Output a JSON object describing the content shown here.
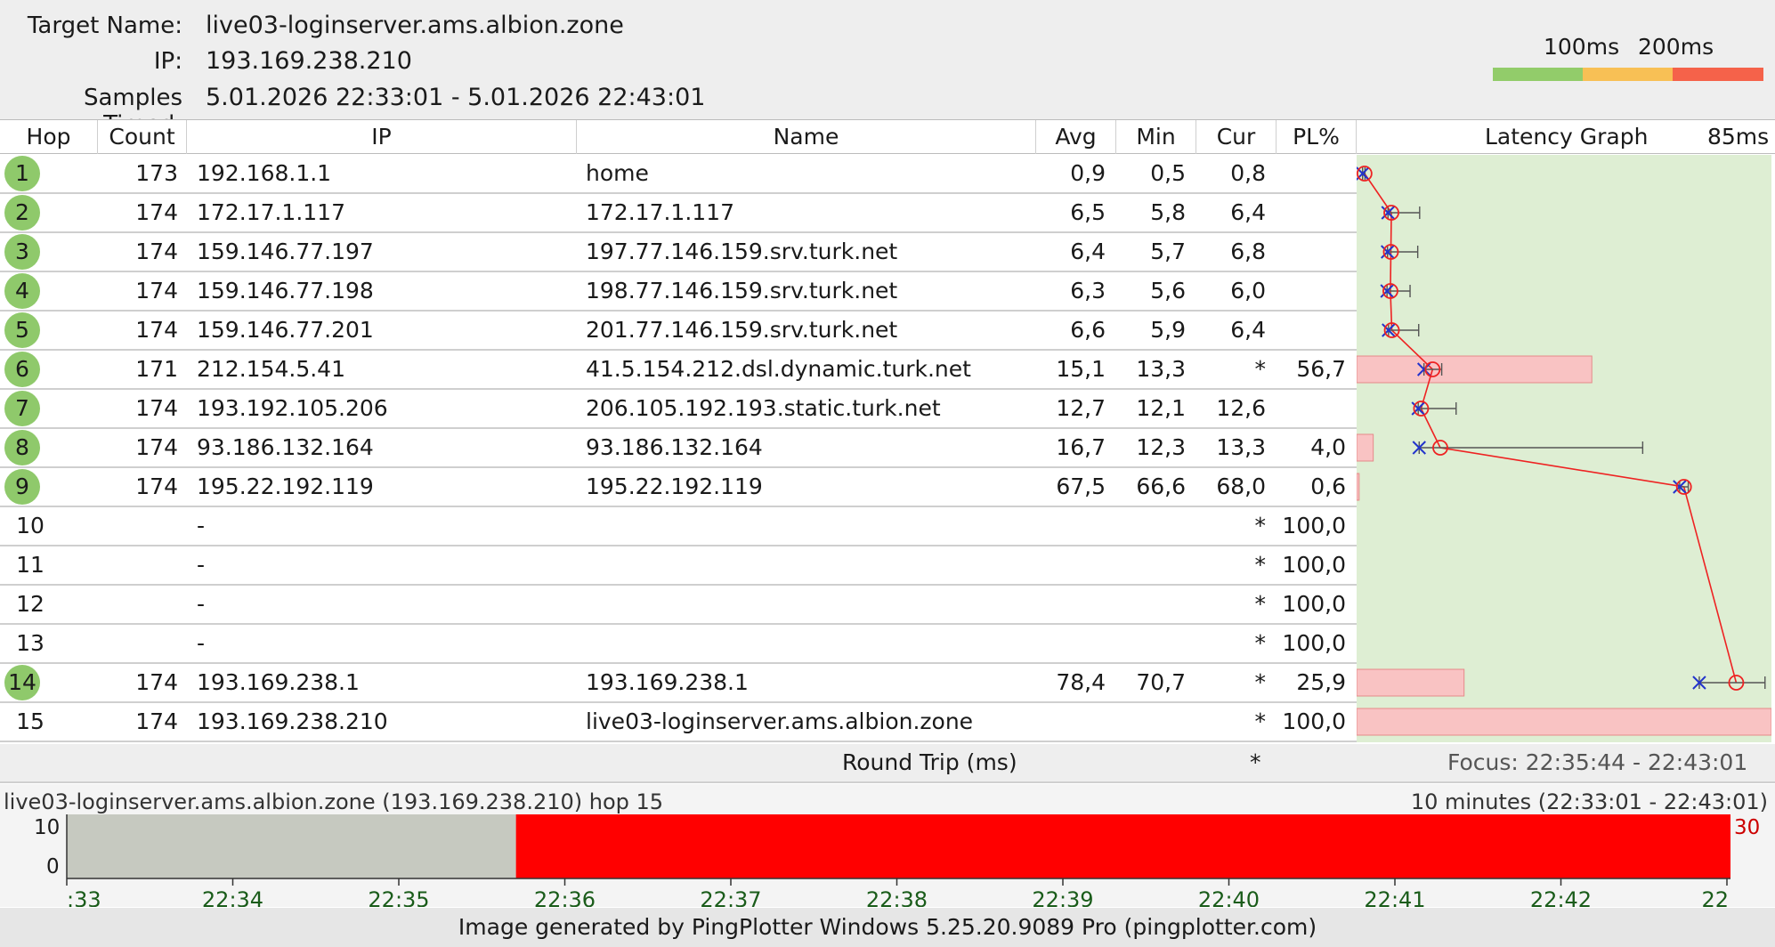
{
  "header": {
    "target_label": "Target Name:",
    "target_value": "live03-loginserver.ams.albion.zone",
    "ip_label": "IP:",
    "ip_value": "193.169.238.210",
    "samples_label": "Samples Timed:",
    "samples_value": "5.01.2026 22:33:01 - 5.01.2026 22:43:01",
    "legend_100": "100ms",
    "legend_200": "200ms",
    "legend_colors": [
      "#92cc6a",
      "#f8c055",
      "#f5624a"
    ]
  },
  "columns": {
    "hop": "Hop",
    "count": "Count",
    "ip": "IP",
    "name": "Name",
    "avg": "Avg",
    "min": "Min",
    "cur": "Cur",
    "pl": "PL%",
    "graph": "Latency Graph",
    "graph_scale": "85ms"
  },
  "hops": [
    {
      "hop": "1",
      "count": "173",
      "ip": "192.168.1.1",
      "name": "home",
      "avg": "0,9",
      "min": "0,5",
      "cur": "0,8",
      "pl": "",
      "responding": true
    },
    {
      "hop": "2",
      "count": "174",
      "ip": "172.17.1.117",
      "name": "172.17.1.117",
      "avg": "6,5",
      "min": "5,8",
      "cur": "6,4",
      "pl": "",
      "responding": true
    },
    {
      "hop": "3",
      "count": "174",
      "ip": "159.146.77.197",
      "name": "197.77.146.159.srv.turk.net",
      "avg": "6,4",
      "min": "5,7",
      "cur": "6,8",
      "pl": "",
      "responding": true
    },
    {
      "hop": "4",
      "count": "174",
      "ip": "159.146.77.198",
      "name": "198.77.146.159.srv.turk.net",
      "avg": "6,3",
      "min": "5,6",
      "cur": "6,0",
      "pl": "",
      "responding": true
    },
    {
      "hop": "5",
      "count": "174",
      "ip": "159.146.77.201",
      "name": "201.77.146.159.srv.turk.net",
      "avg": "6,6",
      "min": "5,9",
      "cur": "6,4",
      "pl": "",
      "responding": true
    },
    {
      "hop": "6",
      "count": "171",
      "ip": "212.154.5.41",
      "name": "41.5.154.212.dsl.dynamic.turk.net",
      "avg": "15,1",
      "min": "13,3",
      "cur": "*",
      "pl": "56,7",
      "responding": true
    },
    {
      "hop": "7",
      "count": "174",
      "ip": "193.192.105.206",
      "name": "206.105.192.193.static.turk.net",
      "avg": "12,7",
      "min": "12,1",
      "cur": "12,6",
      "pl": "",
      "responding": true
    },
    {
      "hop": "8",
      "count": "174",
      "ip": "93.186.132.164",
      "name": "93.186.132.164",
      "avg": "16,7",
      "min": "12,3",
      "cur": "13,3",
      "pl": "4,0",
      "responding": true
    },
    {
      "hop": "9",
      "count": "174",
      "ip": "195.22.192.119",
      "name": "195.22.192.119",
      "avg": "67,5",
      "min": "66,6",
      "cur": "68,0",
      "pl": "0,6",
      "responding": true
    },
    {
      "hop": "10",
      "count": "",
      "ip": "-",
      "name": "",
      "avg": "",
      "min": "",
      "cur": "*",
      "pl": "100,0",
      "responding": false
    },
    {
      "hop": "11",
      "count": "",
      "ip": "-",
      "name": "",
      "avg": "",
      "min": "",
      "cur": "*",
      "pl": "100,0",
      "responding": false
    },
    {
      "hop": "12",
      "count": "",
      "ip": "-",
      "name": "",
      "avg": "",
      "min": "",
      "cur": "*",
      "pl": "100,0",
      "responding": false
    },
    {
      "hop": "13",
      "count": "",
      "ip": "-",
      "name": "",
      "avg": "",
      "min": "",
      "cur": "*",
      "pl": "100,0",
      "responding": false
    },
    {
      "hop": "14",
      "count": "174",
      "ip": "193.169.238.1",
      "name": "193.169.238.1",
      "avg": "78,4",
      "min": "70,7",
      "cur": "*",
      "pl": "25,9",
      "responding": true
    },
    {
      "hop": "15",
      "count": "174",
      "ip": "193.169.238.210",
      "name": "live03-loginserver.ams.albion.zone",
      "avg": "",
      "min": "",
      "cur": "*",
      "pl": "100,0",
      "responding": false
    }
  ],
  "graph": {
    "scale_max_ms": 85,
    "colors": {
      "bg": "#deeed3",
      "loss": "#f9c3c3",
      "line": "#ee2222",
      "min_marker": "#2233cc"
    },
    "points": [
      {
        "avg": 0.9,
        "min": 0.5,
        "max": 1.0,
        "loss": 0
      },
      {
        "avg": 6.5,
        "min": 5.8,
        "max": 12.4,
        "loss": 0
      },
      {
        "avg": 6.4,
        "min": 5.7,
        "max": 12.0,
        "loss": 0
      },
      {
        "avg": 6.3,
        "min": 5.6,
        "max": 10.4,
        "loss": 0
      },
      {
        "avg": 6.6,
        "min": 5.9,
        "max": 12.2,
        "loss": 0
      },
      {
        "avg": 15.1,
        "min": 13.3,
        "max": 17.0,
        "loss": 56.7
      },
      {
        "avg": 12.7,
        "min": 12.1,
        "max": 20.0,
        "loss": 0
      },
      {
        "avg": 16.7,
        "min": 12.3,
        "max": 58.9,
        "loss": 4.0
      },
      {
        "avg": 67.5,
        "min": 66.6,
        "max": 68.4,
        "loss": 0.6
      },
      {
        "avg": null,
        "min": null,
        "max": null,
        "loss": 0
      },
      {
        "avg": null,
        "min": null,
        "max": null,
        "loss": 0
      },
      {
        "avg": null,
        "min": null,
        "max": null,
        "loss": 0
      },
      {
        "avg": null,
        "min": null,
        "max": null,
        "loss": 0
      },
      {
        "avg": 78.4,
        "min": 70.7,
        "max": 84.4,
        "loss": 25.9
      },
      {
        "avg": null,
        "min": null,
        "max": null,
        "loss": 100
      }
    ]
  },
  "roundtrip": {
    "label": "Round Trip (ms)",
    "cur": "*",
    "focus": "Focus: 22:35:44 - 22:43:01"
  },
  "timeline": {
    "target": "live03-loginserver.ams.albion.zone (193.169.238.210) hop 15",
    "range": "10 minutes (22:33:01 - 22:43:01)",
    "y_top": "10",
    "y_bottom": "0",
    "max_label": "30",
    "ticks": [
      ":33",
      "22:34",
      "22:35",
      "22:36",
      "22:37",
      "22:38",
      "22:39",
      "22:40",
      "22:41",
      "22:42",
      "22"
    ],
    "gray_until_fraction": 0.27,
    "colors": {
      "gray": "#c6c9c0",
      "red": "#ff0000",
      "tick": "#1a5c1a"
    }
  },
  "footer": {
    "text": "Image generated by PingPlotter Windows 5.25.20.9089 Pro (pingplotter.com)"
  }
}
